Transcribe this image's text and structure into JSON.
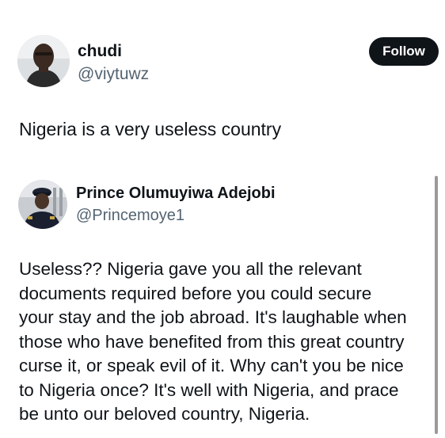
{
  "main_tweet": {
    "author": {
      "name": "chudi",
      "handle": "@viytuwz",
      "avatar_icon": "user-avatar"
    },
    "follow_label": "Follow",
    "text": "Nigeria is a very useless country"
  },
  "quoted_tweet": {
    "author": {
      "name": "Prince Olumuyiwa Adejobi",
      "handle": "@Princemoye1",
      "avatar_icon": "user-avatar"
    },
    "lines": [
      "Useless?? Nigeria gave you all the relevant",
      "documents required before you could secure",
      "your stay and the  job abroad. It's laughable when",
      "those who have benefited from this great country",
      "curse it, or speak evil of it. Why can't you be nice",
      "to Nigeria once? It's well with Nigeria,  and prace",
      "be unto our beloved country, Nigeria."
    ]
  },
  "colors": {
    "text_primary": "#0f1419",
    "text_secondary": "#536471",
    "button_bg": "#0f1419",
    "button_text": "#ffffff"
  }
}
